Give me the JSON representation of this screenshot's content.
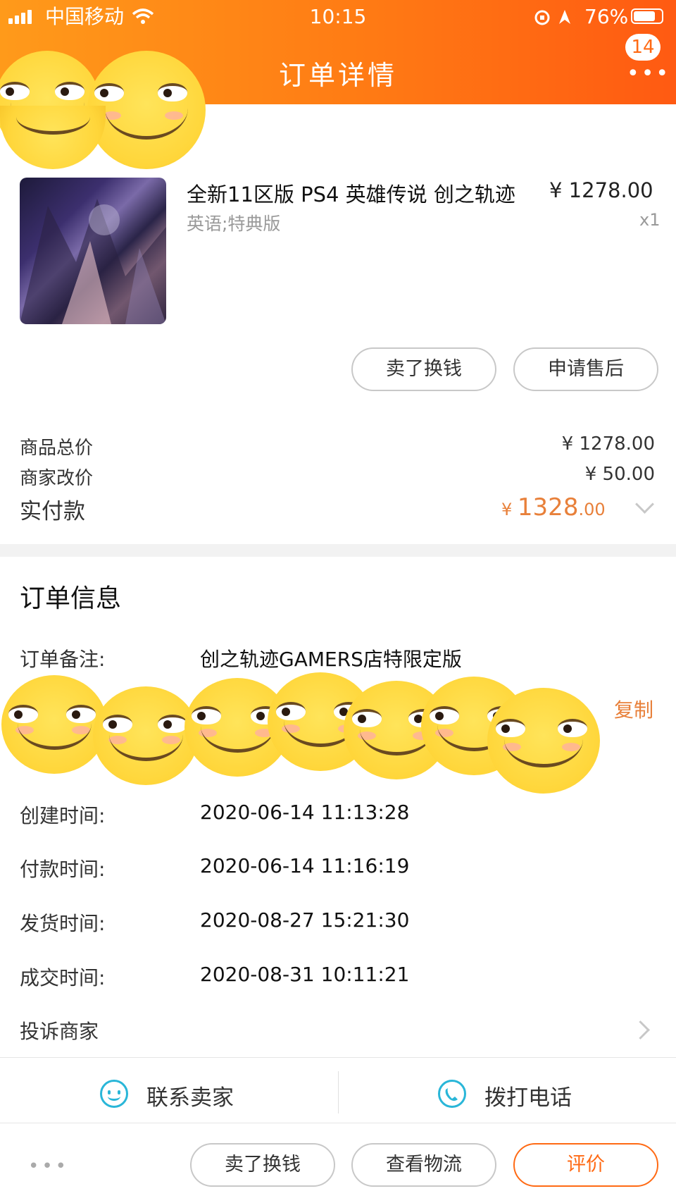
{
  "status_bar": {
    "carrier": "中国移动",
    "time": "10:15",
    "battery": "76%"
  },
  "header": {
    "title": "订单详情",
    "badge": "14",
    "more": "•••"
  },
  "product": {
    "title": "全新11区版 PS4 英雄传说 创之轨迹",
    "variant": "英语;特典版",
    "price": "¥ 1278.00",
    "quantity": "x1"
  },
  "product_actions": {
    "sell_label": "卖了换钱",
    "after_sale_label": "申请售后"
  },
  "summary": {
    "goods_total_label": "商品总价",
    "goods_total_value": "¥ 1278.00",
    "merchant_adjust_label": "商家改价",
    "merchant_adjust_value": "¥ 50.00",
    "paid_label": "实付款",
    "paid_currency": "¥",
    "paid_integer": "1328",
    "paid_decimal": ".00"
  },
  "order_info": {
    "title": "订单信息",
    "note_label": "订单备注:",
    "note_value": "创之轨迹GAMERS店特限定版",
    "copy_label": "复制",
    "created_label": "创建时间:",
    "created_value": "2020-06-14 11:13:28",
    "paid_label": "付款时间:",
    "paid_value": "2020-06-14 11:16:19",
    "shipped_label": "发货时间:",
    "shipped_value": "2020-08-27 15:21:30",
    "completed_label": "成交时间:",
    "completed_value": "2020-08-31 10:11:21",
    "complaint_label": "投诉商家"
  },
  "contact": {
    "seller_label": "联系卖家",
    "call_label": "拨打电话"
  },
  "bottom_bar": {
    "more": "•••",
    "sell_label": "卖了换钱",
    "logistics_label": "查看物流",
    "evaluate_label": "评价"
  },
  "colors": {
    "header_orange": "#ff7a14",
    "accent_orange": "#e8803a",
    "icon_blue": "#29b6d8"
  }
}
